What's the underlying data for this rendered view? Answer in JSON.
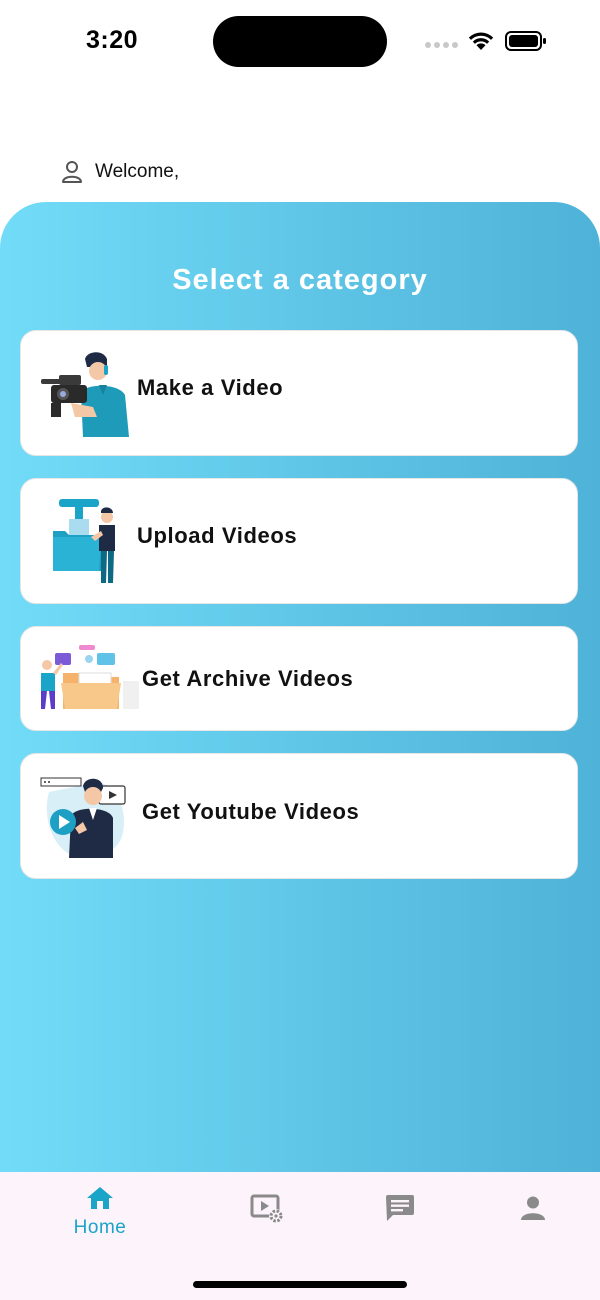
{
  "status_bar": {
    "time": "3:20"
  },
  "welcome": {
    "text": "Welcome,"
  },
  "panel": {
    "title": "Select a category"
  },
  "categories": [
    {
      "label": "Make a Video",
      "icon": "videographer-illustration"
    },
    {
      "label": "Upload Videos",
      "icon": "upload-folder-illustration"
    },
    {
      "label": "Get Archive Videos",
      "icon": "archive-folder-illustration"
    },
    {
      "label": "Get Youtube Videos",
      "icon": "youtube-presenter-illustration"
    }
  ],
  "bottom_nav": {
    "items": [
      {
        "label": "Home",
        "icon": "home-icon",
        "active": true
      },
      {
        "label": "",
        "icon": "video-settings-icon",
        "active": false
      },
      {
        "label": "",
        "icon": "chat-icon",
        "active": false
      },
      {
        "label": "",
        "icon": "person-icon",
        "active": false
      }
    ]
  },
  "colors": {
    "gradient_start": "#72dcf8",
    "gradient_end": "#4fb2d8",
    "accent": "#1aa4c8",
    "nav_background": "#fdf3fa",
    "inactive_icon": "#8a8a8a"
  }
}
